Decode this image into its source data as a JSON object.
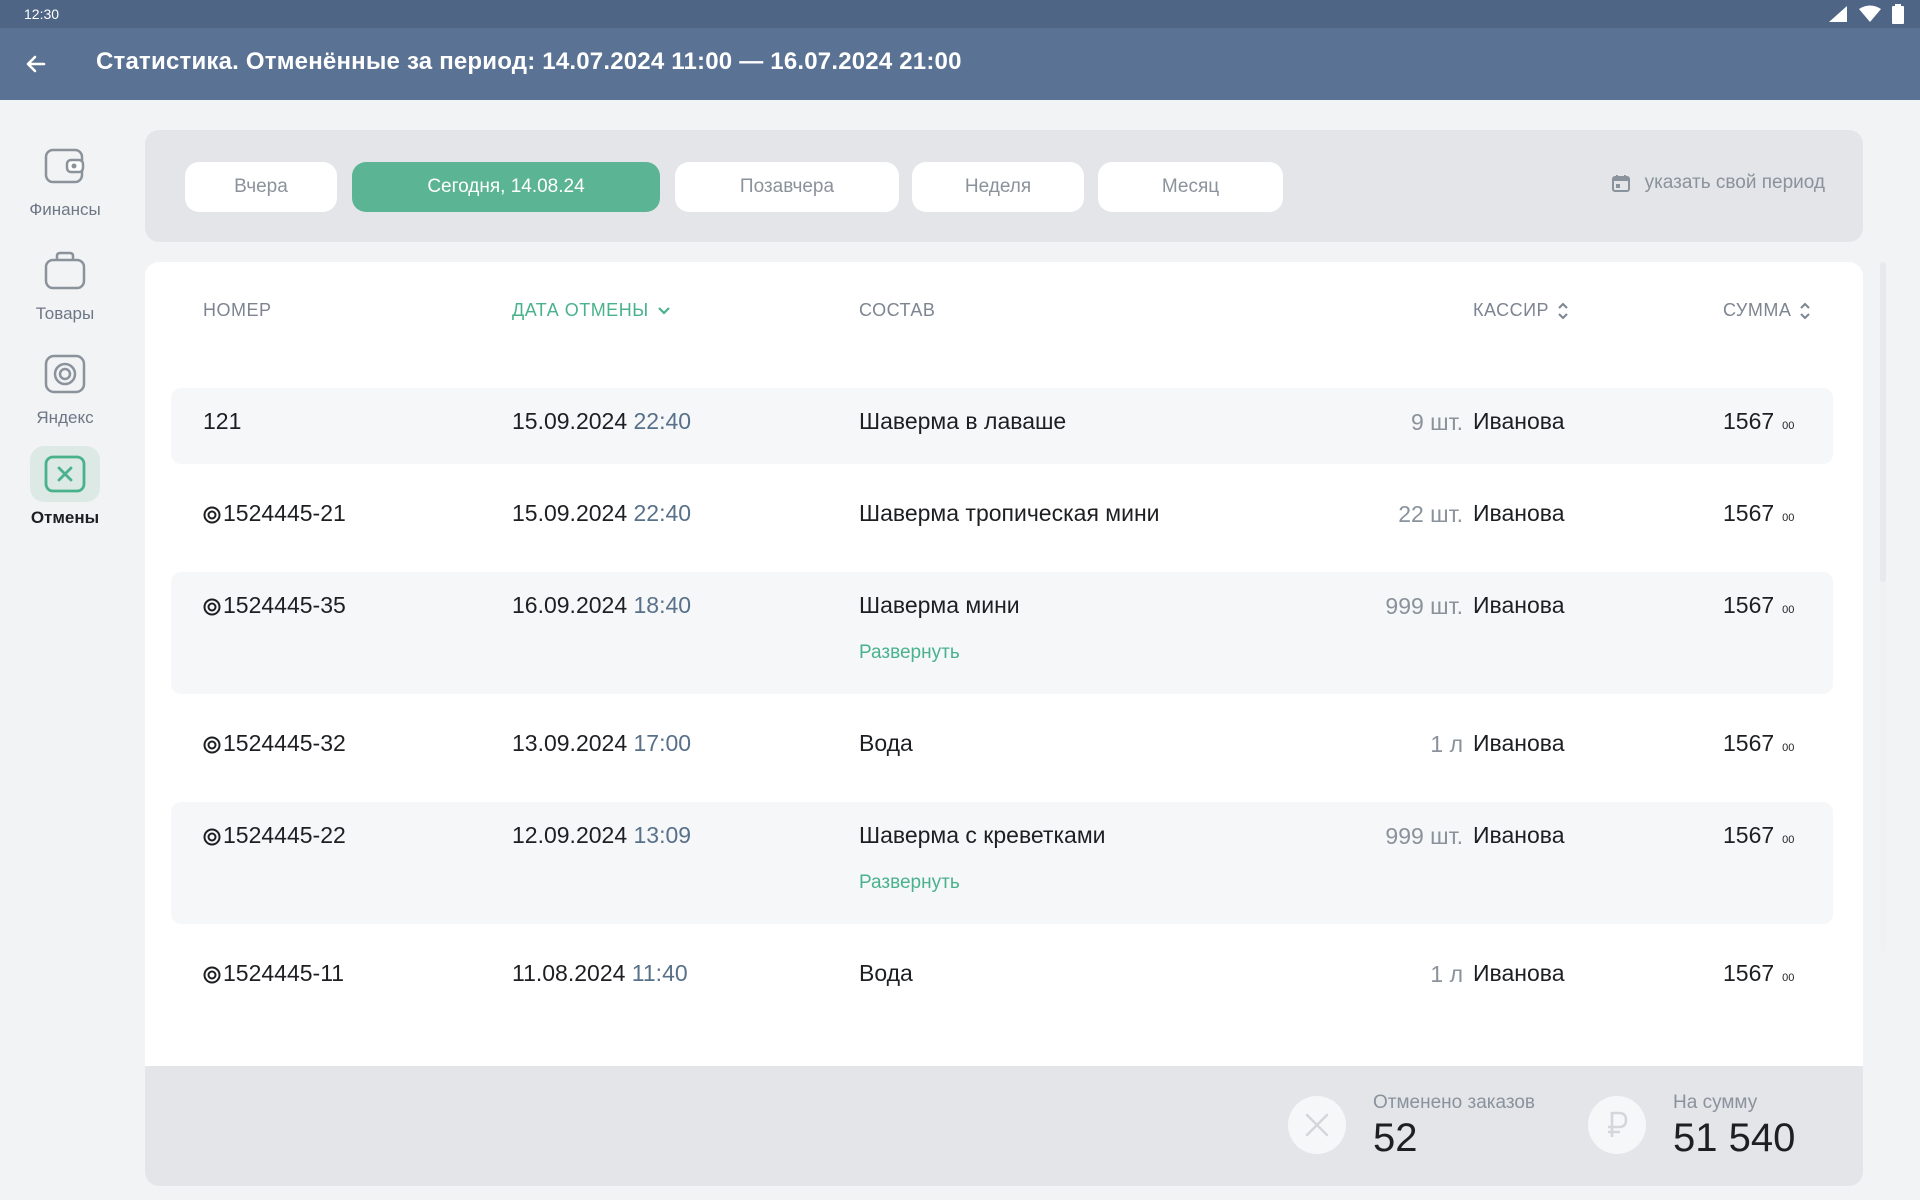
{
  "status_bar": {
    "time": "12:30"
  },
  "app_bar": {
    "title": "Статистика. Отменённые за период: 14.07.2024 11:00 — 16.07.2024 21:00"
  },
  "sidebar": {
    "items": [
      {
        "label": "Финансы",
        "icon": "wallet-icon",
        "active": false
      },
      {
        "label": "Товары",
        "icon": "bag-icon",
        "active": false
      },
      {
        "label": "Яндекс",
        "icon": "yandex-eda-icon",
        "active": false
      },
      {
        "label": "Отмены",
        "icon": "cancel-icon",
        "active": true
      }
    ]
  },
  "period": {
    "chips": [
      "Вчера",
      "Сегодня, 14.08.24",
      "Позавчера",
      "Неделя",
      "Месяц"
    ],
    "active_chip": "Сегодня, 14.08.24",
    "custom_label": "указать  свой период"
  },
  "table": {
    "headers": {
      "number": "НОМЕР",
      "date": "ДАТА  ОТМЕНЫ",
      "items": "СОСТАВ",
      "cashier": "КАССИР",
      "sum": "СУММА"
    },
    "expand_label": "Развернуть",
    "rows": [
      {
        "number": "121",
        "yandex": false,
        "date": "15.09.2024",
        "time": "22:40",
        "item": "Шаверма в лаваше",
        "qty": "9 шт.",
        "cashier": "Иванова",
        "sum": "1567",
        "kop": "00",
        "expandable": false
      },
      {
        "number": "1524445-21",
        "yandex": true,
        "date": "15.09.2024",
        "time": "22:40",
        "item": "Шаверма тропическая мини",
        "qty": "22 шт.",
        "cashier": "Иванова",
        "sum": "1567",
        "kop": "00",
        "expandable": false
      },
      {
        "number": "1524445-35",
        "yandex": true,
        "date": "16.09.2024",
        "time": "18:40",
        "item": "Шаверма  мини",
        "qty": "999 шт.",
        "cashier": "Иванова",
        "sum": "1567",
        "kop": "00",
        "expandable": true
      },
      {
        "number": "1524445-32",
        "yandex": true,
        "date": "13.09.2024",
        "time": "17:00",
        "item": "Вода",
        "qty": "1 л",
        "cashier": "Иванова",
        "sum": "1567",
        "kop": "00",
        "expandable": false
      },
      {
        "number": "1524445-22",
        "yandex": true,
        "date": "12.09.2024",
        "time": "13:09",
        "item": "Шаверма с креветками",
        "qty": "999 шт.",
        "cashier": "Иванова",
        "sum": "1567",
        "kop": "00",
        "expandable": true
      },
      {
        "number": "1524445-11",
        "yandex": true,
        "date": "11.08.2024",
        "time": "11:40",
        "item": "Вода",
        "qty": "1 л",
        "cashier": "Иванова",
        "sum": "1567",
        "kop": "00",
        "expandable": false
      }
    ]
  },
  "footer": {
    "cancelled_label": "Отменено заказов",
    "cancelled_value": "52",
    "sum_label": "На сумму",
    "sum_value": "51 540"
  },
  "colors": {
    "accent": "#5bb493",
    "appbar": "#5a7293",
    "statusbar": "#4f6586"
  }
}
